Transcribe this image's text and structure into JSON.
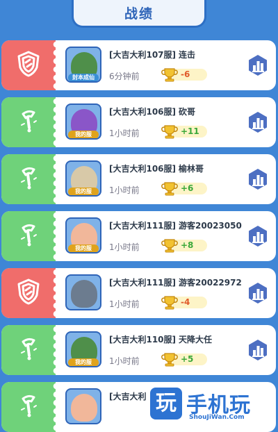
{
  "header": {
    "title": "战绩"
  },
  "records": [
    {
      "result": "lose",
      "server": "[大吉大利107服]",
      "player": "连击",
      "time": "6分钟前",
      "delta": "-6",
      "avatar_caption": "封本成仙",
      "avatar_color": "#4f8f4a",
      "caption_color": "#3a8fd6"
    },
    {
      "result": "win",
      "server": "[大吉大利106服]",
      "player": "砍哥",
      "time": "1小时前",
      "delta": "+11",
      "avatar_caption": "我的服",
      "avatar_color": "#8a56c8",
      "caption_color": "#e0a31c"
    },
    {
      "result": "win",
      "server": "[大吉大利106服]",
      "player": "榆林哥",
      "time": "1小时前",
      "delta": "+6",
      "avatar_caption": "我的服",
      "avatar_color": "#d8c9a8",
      "caption_color": "#e0a31c"
    },
    {
      "result": "win",
      "server": "[大吉大利111服]",
      "player": "游客20023050",
      "time": "1小时前",
      "delta": "+8",
      "avatar_caption": "我的服",
      "avatar_color": "#f1b79a",
      "caption_color": "#e0a31c"
    },
    {
      "result": "lose",
      "server": "[大吉大利111服]",
      "player": "游客20022972",
      "time": "1小时前",
      "delta": "-4",
      "avatar_caption": "",
      "avatar_color": "#6c7c8f",
      "caption_color": "#e0a31c"
    },
    {
      "result": "win",
      "server": "[大吉大利110服]",
      "player": "天降大任",
      "time": "1小时前",
      "delta": "+5",
      "avatar_caption": "我的服",
      "avatar_color": "#4f8f4a",
      "caption_color": "#e0a31c"
    },
    {
      "result": "win",
      "server": "[大吉大利",
      "player": "",
      "time": "",
      "delta": "",
      "avatar_caption": "",
      "avatar_color": "#f1b79a",
      "caption_color": "#e0a31c"
    }
  ],
  "watermark": {
    "logo": "玩",
    "text": "手机玩",
    "url": "ShouJiWan.Com"
  },
  "colors": {
    "lose": "#f06d6b",
    "win": "#6fd27a",
    "accent": "#2e64b8"
  },
  "icons": {
    "lose": "shield-icon",
    "win": "sword-icon",
    "detail": "chart-icon",
    "trophy": "trophy-icon"
  }
}
